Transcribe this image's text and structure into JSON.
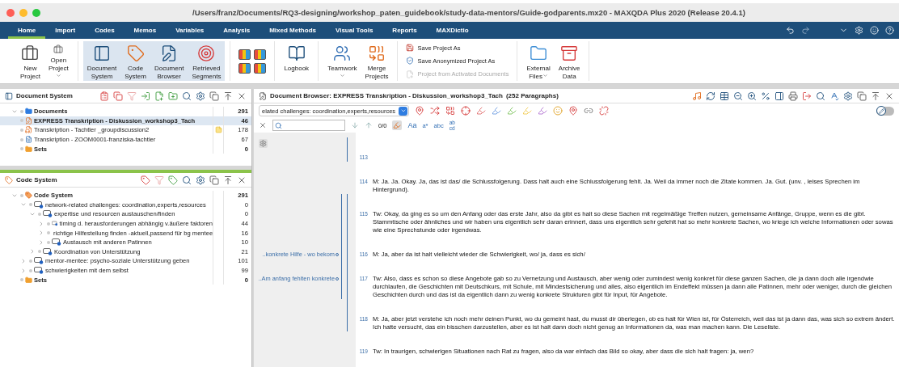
{
  "window": {
    "title": "/Users/franz/Documents/RQ3-designing/workshop_paten_guidebook/study-data-mentors/Guide-godparents.mx20 - MAXQDA Plus 2020 (Release 20.4.1)"
  },
  "ribbon_tabs": [
    {
      "label": "Home",
      "selected": true
    },
    {
      "label": "Import",
      "selected": false
    },
    {
      "label": "Codes",
      "selected": false
    },
    {
      "label": "Memos",
      "selected": false
    },
    {
      "label": "Variables",
      "selected": false
    },
    {
      "label": "Analysis",
      "selected": false
    },
    {
      "label": "Mixed Methods",
      "selected": false
    },
    {
      "label": "Visual Tools",
      "selected": false
    },
    {
      "label": "Reports",
      "selected": false
    },
    {
      "label": "MAXDictio",
      "selected": false
    }
  ],
  "ribbon": [
    {
      "kind": "large",
      "buttons": [
        {
          "label": "New Project",
          "menu": false,
          "active": false
        },
        {
          "label": "Open Project",
          "menu": true,
          "active": false
        }
      ]
    },
    {
      "kind": "large",
      "buttons": [
        {
          "label": "Document System",
          "menu": false,
          "active": true
        },
        {
          "label": "Code System",
          "menu": false,
          "active": true
        },
        {
          "label": "Document Browser",
          "menu": false,
          "active": true
        },
        {
          "label": "Retrieved Segments",
          "menu": false,
          "active": true
        }
      ]
    },
    {
      "kind": "layouts"
    },
    {
      "kind": "large",
      "buttons": [
        {
          "label": "Logbook",
          "menu": false,
          "active": false
        }
      ]
    },
    {
      "kind": "large",
      "buttons": [
        {
          "label": "Teamwork",
          "menu": true,
          "active": false
        },
        {
          "label": "Merge Projects",
          "menu": false,
          "active": false
        }
      ]
    },
    {
      "kind": "small",
      "buttons": [
        {
          "label": "Save Project As",
          "disabled": false
        },
        {
          "label": "Save Anonymized Project As",
          "disabled": false
        },
        {
          "label": "Project from Activated Documents",
          "disabled": true
        }
      ]
    },
    {
      "kind": "large",
      "buttons": [
        {
          "label": "External Files",
          "menu": true,
          "active": false
        },
        {
          "label": "Archive Data",
          "menu": false,
          "active": false
        }
      ]
    }
  ],
  "document_system": {
    "title": "Document System",
    "documents": {
      "label": "Documents",
      "count": "291",
      "expanded": true,
      "children": [
        {
          "label": "EXPRESS Transkription - Diskussion_workshop3_Tach",
          "count": "46",
          "kind": "edited",
          "selected": true,
          "memo": false
        },
        {
          "label": "Transkription - Tachtler _groupdiscussion2",
          "count": "178",
          "kind": "audio",
          "selected": false,
          "memo": true
        },
        {
          "label": "Transkription - ZOOM0001-franziska-tachtler",
          "count": "67",
          "kind": "text",
          "selected": false,
          "memo": false
        }
      ]
    },
    "sets": {
      "label": "Sets",
      "count": "0"
    }
  },
  "code_system": {
    "title": "Code System",
    "root": {
      "label": "Code System",
      "count": "291",
      "expanded": true,
      "children": [
        {
          "label": "network-related challenges: coordination,experts,resources",
          "count": "0",
          "expanded": true,
          "children": [
            {
              "label": "expertise und resourcen austauschen/finden",
              "count": "0",
              "expanded": true,
              "children": [
                {
                  "label": "timing d. herausforderungen abhängig v.äußere faktoren",
                  "count": "44",
                  "expanded": false
                },
                {
                  "label": "richtige Hilfestellung finden -aktuell,passend für bg mentee",
                  "count": "16",
                  "expanded": false
                },
                {
                  "label": "Austausch mit anderen Patinnen",
                  "count": "10",
                  "expanded": false
                }
              ]
            },
            {
              "label": "Koordination von Unterstützung",
              "count": "21",
              "expanded": false
            }
          ]
        },
        {
          "label": "mentor-mentee: psycho-soziale Unterstützung geben",
          "count": "101",
          "expanded": false
        },
        {
          "label": "schwierigkeiten mit dem selbst",
          "count": "99",
          "expanded": false
        }
      ]
    },
    "sets": {
      "label": "Sets",
      "count": "0"
    }
  },
  "document_browser": {
    "title": "Document Browser: EXPRESS Transkription - Diskussion_workshop3_Tach",
    "paragraph_count": "(252 Paragraphs)",
    "code_selector": "elated challenges: coordination,experts,resources",
    "edit_mode": {
      "on": false
    },
    "search": {
      "count": "0/0",
      "options": [
        {
          "kind": "plain",
          "label": "Aa"
        },
        {
          "kind": "plain",
          "label": "a*"
        },
        {
          "kind": "plain",
          "label": "abc"
        },
        {
          "kind": "stacked",
          "top": "ab",
          "bottom": "cd"
        }
      ]
    },
    "paragraphs": [
      {
        "number": "113",
        "coded": [
          false,
          true
        ]
      },
      {
        "number": "114",
        "text": "M: Ja. Ja. Okay. Ja, das ist das/ die Schlussfolgerung. Dass halt auch eine Schlussfolgerung fehlt. Ja. Weil da immer noch die Zitate kommen. Ja. Gut. (unv. , leises Sprechen im Hintergrund).",
        "coded": [
          false,
          false
        ]
      },
      {
        "number": "115",
        "text": "Tw: Okay, da ging es so um den Anfang oder das erste Jahr, also da gibt es halt so diese Sachen mit regelmäßige Treffen nutzen, gemeinsame Anfänge, Gruppe, wenn es die gibt. Stammtische oder ähnliches und wir haben uns eigentlich sehr daran erinnert, dass uns eigentlich sehr gefehlt hat so mehr konkrete Sachen, wo kriege ich welche Informationen oder sowas wie eine Sprechstunde oder irgendwas.",
        "coded": [
          true,
          true
        ]
      },
      {
        "number": "116",
        "text": "M: Ja, aber da ist halt vielleicht wieder die Schwierigkeit, wo/ ja, dass es sich/",
        "coded": [
          true,
          true
        ],
        "memo_label": "..konkrete Hilfe - wo bekom"
      },
      {
        "number": "117",
        "text": "Tw: Also, dass es schon so diese Angebote gab so zu Vernetzung und Austausch, aber wenig oder zumindest wenig konkret für diese ganzen Sachen, die ja dann doch alle irgendwie durchlaufen, die Geschichten mit Deutschkurs, mit Schule, mit Mindestsicherung und alles, also eigentlich im Endeffekt müssen ja dann alle Patinnen, mehr oder weniger, durch die gleichen Geschichten durch und das ist da eigentlich dann zu wenig konkrete Strukturen gibt für Input, für Angebote.",
        "coded": [
          true,
          true
        ],
        "memo_label": "..Am anfang fehlten konkrete"
      },
      {
        "number": "118",
        "text": "M: Ja, aber jetzt verstehe ich noch mehr deinen Punkt, wo du gemeint hast, du musst dir überlegen, ob es halt für Wien ist, für Österreich, weil das ist ja dann das, was sich so extrem ändert. Ich hatte versucht, das ein bisschen darzustellen, aber es ist halt dann doch nicht genug an Informationen da, was man machen kann. Die Leseliste.",
        "coded": [
          false,
          true
        ]
      },
      {
        "number": "119",
        "text": "Tw: In traurigen, schwierigen Situationen nach Rat zu fragen, also da war einfach das Bild so okay, aber dass die sich halt fragen: ja, wen?",
        "coded": [
          false,
          false
        ]
      }
    ]
  }
}
